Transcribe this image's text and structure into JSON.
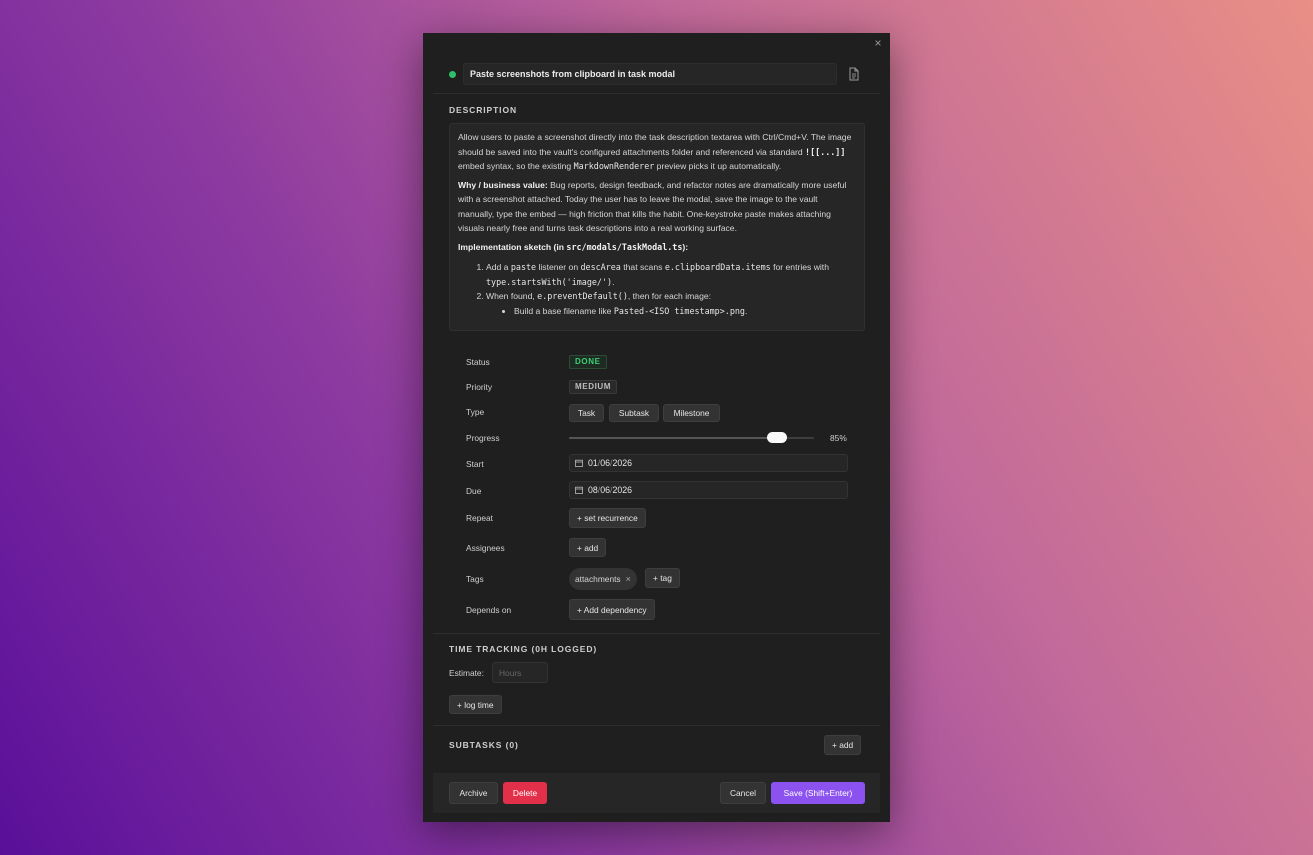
{
  "modal": {
    "title": "Paste screenshots from clipboard in task modal",
    "close_glyph": "×",
    "icons": {
      "close": "close-icon",
      "document": "document-icon",
      "status_dot": "status-dot",
      "calendar": "calendar-icon"
    },
    "colors": {
      "status_dot": "#2ebf6a",
      "status_done": "#3ccf73",
      "delete": "#e3304a",
      "save": "#8b52f0"
    }
  },
  "description": {
    "heading": "DESCRIPTION",
    "p1": {
      "a": "Allow users to paste a screenshot directly into the task description textarea with Ctrl/Cmd+V. The image should be saved into the vault's configured attachments folder and referenced via standard ",
      "code1": "![[...]]",
      "b": " embed syntax, so the existing ",
      "code2": "MarkdownRenderer",
      "c": " preview picks it up automatically."
    },
    "p2": {
      "bold": "Why / business value:",
      "text": " Bug reports, design feedback, and refactor notes are dramatically more useful with a screenshot attached. Today the user has to leave the modal, save the image to the vault manually, type the embed — high friction that kills the habit. One-keystroke paste makes attaching visuals nearly free and turns task descriptions into a real working surface."
    },
    "p3": {
      "bold_a": "Implementation sketch (in ",
      "code": "src/modals/TaskModal.ts",
      "bold_b": "):"
    },
    "li1": {
      "a": "Add a ",
      "code1": "paste",
      "b": " listener on ",
      "code2": "descArea",
      "c": " that scans ",
      "code3": "e.clipboardData.items",
      "d": " for entries with ",
      "code4": "type.startsWith('image/')",
      "e": "."
    },
    "li2": {
      "a": "When found, ",
      "code1": "e.preventDefault()",
      "b": ", then for each image:"
    },
    "li2_sub1": {
      "a": "Build a base filename like ",
      "code1": "Pasted-<ISO timestamp>.png",
      "b": "."
    }
  },
  "fields": {
    "status_label": "Status",
    "status_value": "DONE",
    "priority_label": "Priority",
    "priority_value": "MEDIUM",
    "type_label": "Type",
    "type_options": [
      "Task",
      "Subtask",
      "Milestone"
    ],
    "progress_label": "Progress",
    "progress_fraction": 0.85,
    "progress_text": "85%",
    "start_label": "Start",
    "start_value": {
      "day": "01",
      "month": "06",
      "year": "2026"
    },
    "due_label": "Due",
    "due_value": {
      "day": "08",
      "month": "06",
      "year": "2026"
    },
    "date_sep": "/",
    "repeat_label": "Repeat",
    "repeat_button": "+ set recurrence",
    "assignees_label": "Assignees",
    "assignees_button": "+ add",
    "tags_label": "Tags",
    "tags": [
      "attachments"
    ],
    "tag_remove_glyph": "×",
    "tag_button": "+ tag",
    "depends_label": "Depends on",
    "depends_button": "+ Add dependency"
  },
  "time_tracking": {
    "heading": "TIME TRACKING (0H LOGGED)",
    "estimate_label": "Estimate:",
    "estimate_placeholder": "Hours",
    "log_button": "+ log time"
  },
  "subtasks": {
    "heading": "SUBTASKS (0)",
    "add_button": "+ add"
  },
  "footer": {
    "archive": "Archive",
    "delete": "Delete",
    "cancel": "Cancel",
    "save": "Save (Shift+Enter)"
  }
}
